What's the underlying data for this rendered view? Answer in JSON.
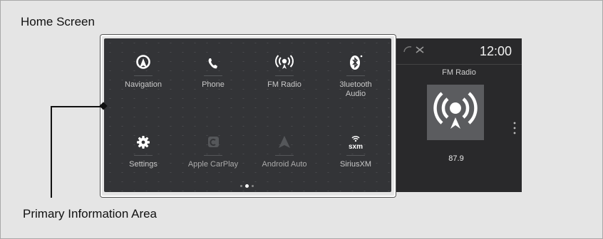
{
  "figure": {
    "heading": "Home Screen",
    "caption": "Primary Information Area"
  },
  "home_menu": {
    "items": [
      {
        "label": "Navigation",
        "icon": "navigation-icon"
      },
      {
        "label": "Phone",
        "icon": "phone-icon"
      },
      {
        "label": "FM Radio",
        "icon": "fm-radio-icon"
      },
      {
        "label": "3luetooth\nAudio",
        "icon": "bluetooth-icon"
      },
      {
        "label": "Settings",
        "icon": "settings-gear-icon"
      },
      {
        "label": "Apple CarPlay",
        "icon": "apple-carplay-icon"
      },
      {
        "label": "Android Auto",
        "icon": "android-auto-icon"
      },
      {
        "label": "SiriusXM",
        "icon": "siriusxm-icon",
        "icon_text": "sxm"
      }
    ],
    "page_indicator": {
      "pages": 3,
      "current": 2
    }
  },
  "side_panel": {
    "time": "12:00",
    "source": "FM Radio",
    "frequency": "87.9",
    "status_icons": [
      "phone-signal-icon",
      "no-signal-icon"
    ]
  },
  "colors": {
    "page_background": "#e5e5e5",
    "screen_background": "#333437",
    "side_background": "#29292b",
    "highlight_border": "#ffffff"
  }
}
